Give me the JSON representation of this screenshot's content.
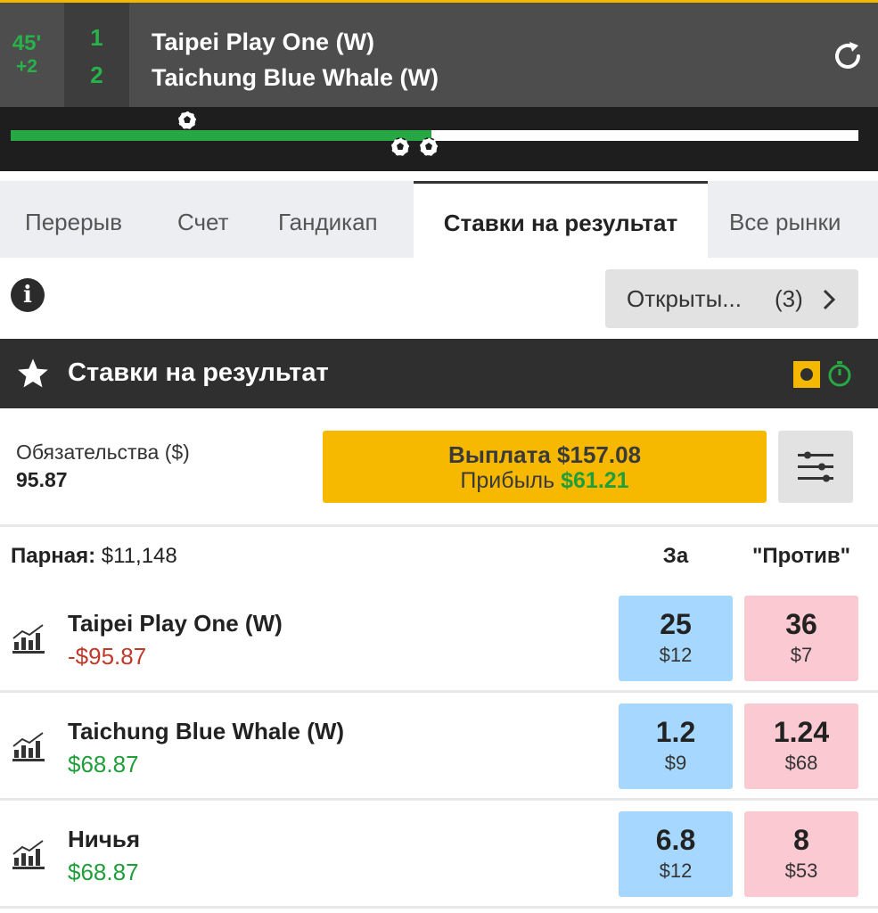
{
  "match": {
    "minute": "45'",
    "added_time": "+2",
    "home_score": "1",
    "away_score": "2",
    "home_team": "Taipei Play One (W)",
    "away_team": "Taichung Blue Whale (W)",
    "refresh_icon": "refresh-icon",
    "progress": 0.496
  },
  "tabs": [
    {
      "label": "Перерыв"
    },
    {
      "label": "Счет"
    },
    {
      "label": "Гандикап"
    },
    {
      "label": "Ставки на результат",
      "active": true
    },
    {
      "label": "Все рынки"
    }
  ],
  "open_bets": {
    "label": "Открыты...",
    "count": "(3)"
  },
  "section": {
    "title": "Ставки на результат",
    "icons": [
      "star-icon",
      "live-icon",
      "timer-icon"
    ]
  },
  "liability": {
    "label": "Обязательства ($)",
    "value": "95.87"
  },
  "payout": {
    "label": "Выплата $157.08",
    "profit_label": "Прибыль",
    "profit_value": "$61.21"
  },
  "market": {
    "matched_label": "Парная:",
    "matched_value": "$11,148",
    "back_header": "За",
    "lay_header": "\"Против\"",
    "runners": [
      {
        "name": "Taipei Play One (W)",
        "pl": "-$95.87",
        "back_price": "25",
        "back_size": "$12",
        "lay_price": "36",
        "lay_size": "$7"
      },
      {
        "name": "Taichung Blue Whale (W)",
        "pl": "$68.87",
        "back_price": "1.2",
        "back_size": "$9",
        "lay_price": "1.24",
        "lay_size": "$68"
      },
      {
        "name": "Ничья",
        "pl": "$68.87",
        "back_price": "6.8",
        "back_size": "$12",
        "lay_price": "8",
        "lay_size": "$53"
      }
    ]
  },
  "colors": {
    "accent_yellow": "#f7b900",
    "green": "#27a844",
    "back_blue": "#a6d8ff",
    "lay_pink": "#fac9d1",
    "loss_red": "#c0392b"
  }
}
